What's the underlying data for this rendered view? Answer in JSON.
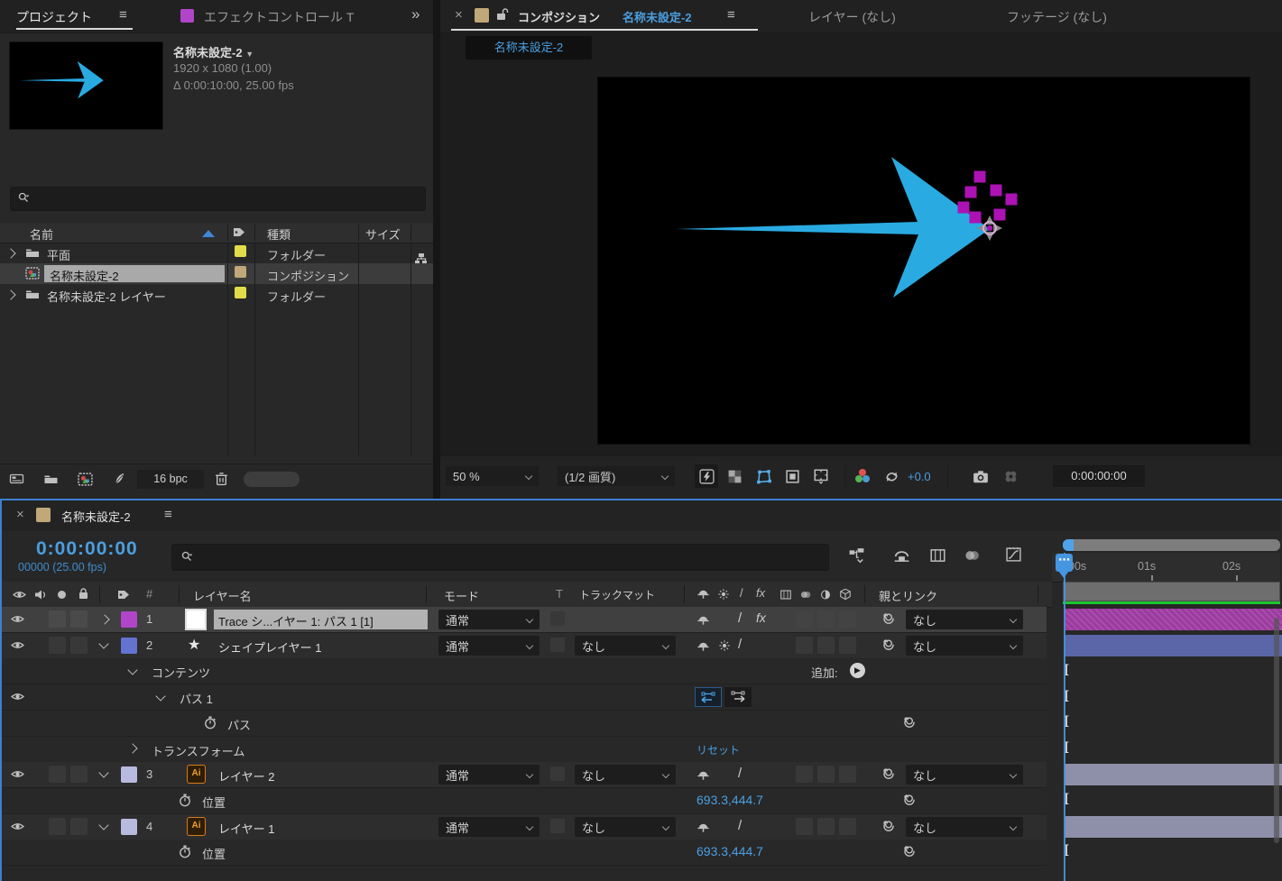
{
  "icons": {
    "menu": "≡",
    "overflow": "»",
    "caret_down": "▼",
    "star": "★",
    "ai": "Ai",
    "fx": "fx",
    "slash": "/",
    "play": "▶",
    "dots": "⋯",
    "close": "×",
    "hash": "#"
  },
  "colors": {
    "accent_blue": "#4b9fe0",
    "cyan_arrow": "#29abe2",
    "point_magenta": "#ac12b4",
    "label_yellow": "#e0dc4a",
    "label_tan": "#c0a878",
    "label_magenta": "#b145c7",
    "label_blue": "#6473cf",
    "label_lavender": "#b9badf",
    "bar_magenta": "#9c3aa0",
    "bar_slate": "#5a66a8",
    "bar_lavender": "#8e8fa9",
    "cache_green": "#1cc62f"
  },
  "project": {
    "tab_project": "プロジェクト",
    "tab_effects": "エフェクトコントロール T",
    "preview": {
      "name": "名称未設定-2",
      "dimensions": "1920 x 1080 (1.00)",
      "duration": "Δ 0:00:10:00, 25.00 fps"
    },
    "columns": {
      "name": "名前",
      "type": "種類",
      "size": "サイズ"
    },
    "rows": [
      {
        "name": "平面",
        "type": "フォルダー"
      },
      {
        "name": "名称未設定-2",
        "type": "コンポジション"
      },
      {
        "name": "名称未設定-2 レイヤー",
        "type": "フォルダー"
      }
    ],
    "footer": {
      "bpc": "16 bpc"
    }
  },
  "comp": {
    "title": "コンポジション",
    "name": "名称未設定-2",
    "tab_layer": "レイヤー (なし)",
    "tab_footage": "フッテージ (なし)",
    "sub_tab": "名称未設定-2",
    "toolbar": {
      "zoom": "50 %",
      "quality": "(1/2 画質)",
      "exposure": "+0.0",
      "timecode": "0:00:00:00"
    }
  },
  "timeline": {
    "tab": "名称未設定-2",
    "timecode": "0:00:00:00",
    "frames": "00000 (25.00 fps)",
    "headers": {
      "layer_name": "レイヤー名",
      "mode": "モード",
      "t": "T",
      "matte": "トラックマット",
      "parent": "親とリンク"
    },
    "ruler": {
      "t0": "00s",
      "t1": "01s",
      "t2": "02s"
    },
    "rows": [
      {
        "num": "1",
        "name": "Trace シ...イヤー 1: パス 1 [1]",
        "mode": "通常",
        "parent": "なし"
      },
      {
        "num": "2",
        "name": "シェイプレイヤー 1",
        "mode": "通常",
        "matte": "なし",
        "parent": "なし"
      },
      {
        "name": "コンテンツ",
        "add_label": "追加:"
      },
      {
        "name": "パス 1"
      },
      {
        "name": "パス"
      },
      {
        "name": "トランスフォーム",
        "reset_label": "リセット"
      },
      {
        "num": "3",
        "name": "レイヤー 2",
        "mode": "通常",
        "matte": "なし",
        "parent": "なし"
      },
      {
        "name": "位置",
        "value": "693.3,444.7"
      },
      {
        "num": "4",
        "name": "レイヤー 1",
        "mode": "通常",
        "matte": "なし",
        "parent": "なし"
      },
      {
        "name": "位置",
        "value": "693.3,444.7"
      }
    ]
  }
}
